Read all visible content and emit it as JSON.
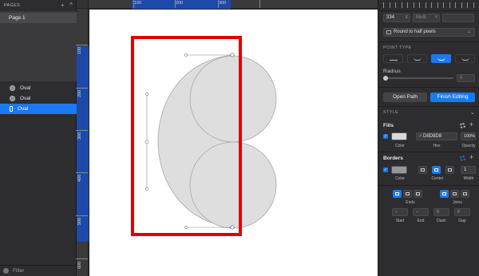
{
  "sidebar": {
    "pages_header": "PAGES",
    "add_icon": "+",
    "collapse_icon": "^",
    "pages": [
      {
        "label": "Page 1"
      }
    ],
    "layers": [
      {
        "label": "Oval",
        "selected": false
      },
      {
        "label": "Oval",
        "selected": false
      },
      {
        "label": "Oval",
        "selected": true
      }
    ],
    "filter_label": "Filter"
  },
  "rulers": {
    "h_labels": [
      "100",
      "200",
      "300"
    ],
    "v_labels": [
      "100",
      "200",
      "300",
      "400",
      "500",
      "600"
    ]
  },
  "inspector": {
    "x_value": "334",
    "x_suffix": "X",
    "y_value": "Multi",
    "y_suffix": "Y",
    "pixel_rounding": "Round to half pixels",
    "point_type_label": "POINT TYPE",
    "radius_label": "Radius",
    "radius_value": "0",
    "open_path_label": "Open Path",
    "finish_editing_label": "Finish Editing",
    "style_label": "STYLE",
    "fills": {
      "header": "Fills",
      "hex_value": "D8D8D8",
      "hex_prefix": "#",
      "opacity_value": "100%",
      "color_label": "Color",
      "hex_label": "Hex",
      "opacity_label": "Opacity",
      "swatch_color": "#D8D8D8"
    },
    "borders": {
      "header": "Borders",
      "color_label": "Color",
      "center_label": "Center",
      "width_label": "Width",
      "width_value": "1",
      "swatch_color": "#979797"
    },
    "ends_label": "Ends",
    "joins_label": "Joins",
    "start_label": "Start",
    "end_label": "End",
    "dash_label": "Dash",
    "gap_label": "Gap",
    "dash_value": "0",
    "gap_value": "0",
    "start_value": "–",
    "end_value": "–"
  },
  "colors": {
    "accent": "#1A79F3",
    "highlight_box": "#E00000",
    "shape_fill": "#DEDEDE",
    "shape_stroke": "#A8A8A8"
  }
}
